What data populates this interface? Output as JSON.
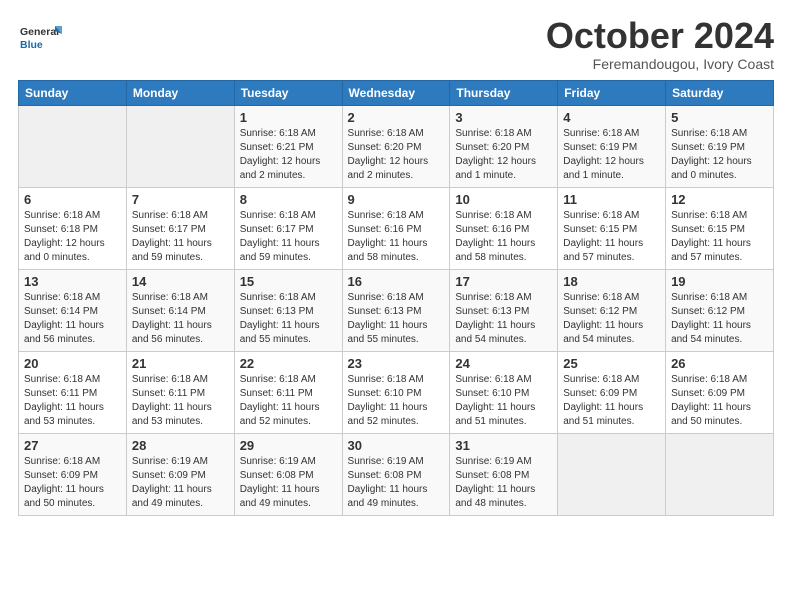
{
  "header": {
    "title": "October 2024",
    "subtitle": "Feremandougou, Ivory Coast"
  },
  "calendar": {
    "headers": [
      "Sunday",
      "Monday",
      "Tuesday",
      "Wednesday",
      "Thursday",
      "Friday",
      "Saturday"
    ],
    "rows": [
      [
        {
          "day": "",
          "info": ""
        },
        {
          "day": "",
          "info": ""
        },
        {
          "day": "1",
          "info": "Sunrise: 6:18 AM\nSunset: 6:21 PM\nDaylight: 12 hours and 2 minutes."
        },
        {
          "day": "2",
          "info": "Sunrise: 6:18 AM\nSunset: 6:20 PM\nDaylight: 12 hours and 2 minutes."
        },
        {
          "day": "3",
          "info": "Sunrise: 6:18 AM\nSunset: 6:20 PM\nDaylight: 12 hours and 1 minute."
        },
        {
          "day": "4",
          "info": "Sunrise: 6:18 AM\nSunset: 6:19 PM\nDaylight: 12 hours and 1 minute."
        },
        {
          "day": "5",
          "info": "Sunrise: 6:18 AM\nSunset: 6:19 PM\nDaylight: 12 hours and 0 minutes."
        }
      ],
      [
        {
          "day": "6",
          "info": "Sunrise: 6:18 AM\nSunset: 6:18 PM\nDaylight: 12 hours and 0 minutes."
        },
        {
          "day": "7",
          "info": "Sunrise: 6:18 AM\nSunset: 6:17 PM\nDaylight: 11 hours and 59 minutes."
        },
        {
          "day": "8",
          "info": "Sunrise: 6:18 AM\nSunset: 6:17 PM\nDaylight: 11 hours and 59 minutes."
        },
        {
          "day": "9",
          "info": "Sunrise: 6:18 AM\nSunset: 6:16 PM\nDaylight: 11 hours and 58 minutes."
        },
        {
          "day": "10",
          "info": "Sunrise: 6:18 AM\nSunset: 6:16 PM\nDaylight: 11 hours and 58 minutes."
        },
        {
          "day": "11",
          "info": "Sunrise: 6:18 AM\nSunset: 6:15 PM\nDaylight: 11 hours and 57 minutes."
        },
        {
          "day": "12",
          "info": "Sunrise: 6:18 AM\nSunset: 6:15 PM\nDaylight: 11 hours and 57 minutes."
        }
      ],
      [
        {
          "day": "13",
          "info": "Sunrise: 6:18 AM\nSunset: 6:14 PM\nDaylight: 11 hours and 56 minutes."
        },
        {
          "day": "14",
          "info": "Sunrise: 6:18 AM\nSunset: 6:14 PM\nDaylight: 11 hours and 56 minutes."
        },
        {
          "day": "15",
          "info": "Sunrise: 6:18 AM\nSunset: 6:13 PM\nDaylight: 11 hours and 55 minutes."
        },
        {
          "day": "16",
          "info": "Sunrise: 6:18 AM\nSunset: 6:13 PM\nDaylight: 11 hours and 55 minutes."
        },
        {
          "day": "17",
          "info": "Sunrise: 6:18 AM\nSunset: 6:13 PM\nDaylight: 11 hours and 54 minutes."
        },
        {
          "day": "18",
          "info": "Sunrise: 6:18 AM\nSunset: 6:12 PM\nDaylight: 11 hours and 54 minutes."
        },
        {
          "day": "19",
          "info": "Sunrise: 6:18 AM\nSunset: 6:12 PM\nDaylight: 11 hours and 54 minutes."
        }
      ],
      [
        {
          "day": "20",
          "info": "Sunrise: 6:18 AM\nSunset: 6:11 PM\nDaylight: 11 hours and 53 minutes."
        },
        {
          "day": "21",
          "info": "Sunrise: 6:18 AM\nSunset: 6:11 PM\nDaylight: 11 hours and 53 minutes."
        },
        {
          "day": "22",
          "info": "Sunrise: 6:18 AM\nSunset: 6:11 PM\nDaylight: 11 hours and 52 minutes."
        },
        {
          "day": "23",
          "info": "Sunrise: 6:18 AM\nSunset: 6:10 PM\nDaylight: 11 hours and 52 minutes."
        },
        {
          "day": "24",
          "info": "Sunrise: 6:18 AM\nSunset: 6:10 PM\nDaylight: 11 hours and 51 minutes."
        },
        {
          "day": "25",
          "info": "Sunrise: 6:18 AM\nSunset: 6:09 PM\nDaylight: 11 hours and 51 minutes."
        },
        {
          "day": "26",
          "info": "Sunrise: 6:18 AM\nSunset: 6:09 PM\nDaylight: 11 hours and 50 minutes."
        }
      ],
      [
        {
          "day": "27",
          "info": "Sunrise: 6:18 AM\nSunset: 6:09 PM\nDaylight: 11 hours and 50 minutes."
        },
        {
          "day": "28",
          "info": "Sunrise: 6:19 AM\nSunset: 6:09 PM\nDaylight: 11 hours and 49 minutes."
        },
        {
          "day": "29",
          "info": "Sunrise: 6:19 AM\nSunset: 6:08 PM\nDaylight: 11 hours and 49 minutes."
        },
        {
          "day": "30",
          "info": "Sunrise: 6:19 AM\nSunset: 6:08 PM\nDaylight: 11 hours and 49 minutes."
        },
        {
          "day": "31",
          "info": "Sunrise: 6:19 AM\nSunset: 6:08 PM\nDaylight: 11 hours and 48 minutes."
        },
        {
          "day": "",
          "info": ""
        },
        {
          "day": "",
          "info": ""
        }
      ]
    ]
  }
}
